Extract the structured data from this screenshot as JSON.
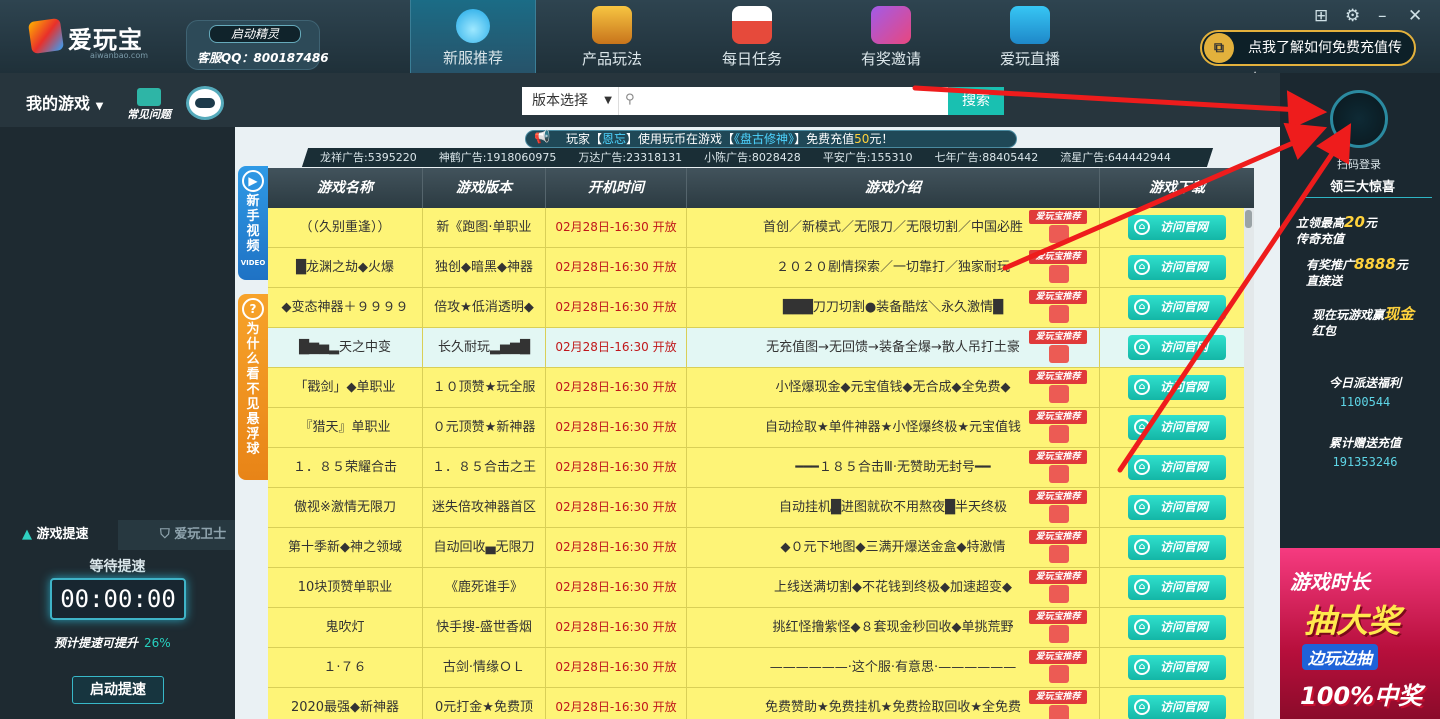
{
  "app": {
    "name": "爱玩宝",
    "domain": "aiwanbao.com"
  },
  "helper": {
    "button": "启动精灵",
    "qq": "客服QQ：800187486"
  },
  "nav": [
    {
      "label": "新服推荐",
      "icon": "drop-icon",
      "active": true
    },
    {
      "label": "产品玩法",
      "icon": "treasure-chest-icon",
      "active": false
    },
    {
      "label": "每日任务",
      "icon": "calendar-icon",
      "active": false
    },
    {
      "label": "有奖邀请",
      "icon": "invite-card-icon",
      "active": false
    },
    {
      "label": "爱玩直播",
      "icon": "tv-icon",
      "active": false
    }
  ],
  "recharge": {
    "label": "点我了解如何免费充值传奇"
  },
  "subbar": {
    "mygames": "我的游戏",
    "faq": "常见问题"
  },
  "search": {
    "version_label": "版本选择",
    "placeholder": "",
    "button": "搜索"
  },
  "ticker": {
    "p1": "玩家【",
    "player": "恩忘",
    "p2": "】使用玩币在游戏【",
    "game": "《盘古修神》",
    "p3": "】免费充值",
    "amount": "50",
    "p4": "元！"
  },
  "ads": [
    "龙祥广告:5395220",
    "神鹤广告:1918060975",
    "万达广告:23318131",
    "小陈广告:8028428",
    "平安广告:155310",
    "七年广告:88405442",
    "流星广告:644442944"
  ],
  "sidetabs": {
    "video": {
      "text": "新手视频",
      "sub": "VIDEO"
    },
    "question": {
      "text": "为什么看不见悬浮球"
    }
  },
  "table": {
    "headers": [
      "游戏名称",
      "游戏版本",
      "开机时间",
      "游戏介绍",
      "游戏下载"
    ],
    "badge": "爱玩宝推荐",
    "visit": "访问官网",
    "rows": [
      {
        "name": "（（久别重逢））",
        "version": "新《跑图·单职业",
        "time": "02月28日-16:30 开放",
        "intro": "首创／新模式／无限刀／无限切割／中国必胜"
      },
      {
        "name": "█龙渊之劫◆火爆",
        "version": "独创◆暗黑◆神器",
        "time": "02月28日-16:30 开放",
        "intro": "２０２０剧情探索／一切靠打／独家耐玩"
      },
      {
        "name": "◆变态神器＋９９９９",
        "version": "倍攻★低消透明◆",
        "time": "02月28日-16:30 开放",
        "intro": "███刀刀切割●装备酷炫＼永久激情█"
      },
      {
        "name": "█▆▅▂天之中变",
        "version": "长久耐玩▂▅▆█",
        "time": "02月28日-16:30 开放",
        "intro": "无充值图→无回馈→装备全爆→散人吊打土豪"
      },
      {
        "name": "「戳剑」◆单职业",
        "version": "１０顶赞★玩全服",
        "time": "02月28日-16:30 开放",
        "intro": "小怪爆现金◆元宝值钱◆无合成◆全免费◆"
      },
      {
        "name": "『猎天』单职业",
        "version": "０元顶赞★新神器",
        "time": "02月28日-16:30 开放",
        "intro": "自动捡取★单件神器★小怪爆终极★元宝值钱"
      },
      {
        "name": "１．８５荣耀合击",
        "version": "１．８５合击之王",
        "time": "02月28日-16:30 开放",
        "intro": "━━━１８５合击Ⅲ·无赞助无封号━━"
      },
      {
        "name": "傲视※激情无限刀",
        "version": "迷失倍攻神器首区",
        "time": "02月28日-16:30 开放",
        "intro": "自动挂机█进图就砍不用熬夜█半天终极"
      },
      {
        "name": "第十季新◆神之领域",
        "version": "自动回收▄无限刀",
        "time": "02月28日-16:30 开放",
        "intro": "◆０元下地图◆三满开爆送金盒◆特激情"
      },
      {
        "name": "10块顶赞单职业",
        "version": "《鹿死谁手》",
        "time": "02月28日-16:30 开放",
        "intro": "上线送满切割◆不花钱到终极◆加速超变◆"
      },
      {
        "name": "鬼吹灯",
        "version": "快手搜-盛世香烟",
        "time": "02月28日-16:30 开放",
        "intro": "挑红怪撸紫怪◆８套现金秒回收◆单挑荒野"
      },
      {
        "name": "１·７６",
        "version": "古剑·情缘ＯＬ",
        "time": "02月28日-16:30 开放",
        "intro": "——————·这个服·有意思·——————"
      },
      {
        "name": "2020最强◆新神器",
        "version": "0元打金★免费顶",
        "time": "02月28日-16:30 开放",
        "intro": "免费赞助★免费挂机★免费捡取回收★全免费"
      }
    ]
  },
  "boost": {
    "tab_active": "游戏提速",
    "tab_other": "爱玩卫士",
    "waiting": "等待提速",
    "timer": "00:00:00",
    "predict_label": "预计提速可提升",
    "predict_value": "26%",
    "start": "启动提速"
  },
  "right": {
    "scan": "扫码登录",
    "gift": "领三大惊喜",
    "promo1": {
      "a": "立领最高",
      "num": "20",
      "b": "元",
      "c": "传奇充值"
    },
    "promo2": {
      "a": "有奖推广",
      "num": "8888",
      "b": "元",
      "c": "直接送"
    },
    "promo3": {
      "a": "现在玩游戏赢",
      "num": "现金",
      "c": "红包"
    },
    "stat1": {
      "label": "今日派送福利",
      "value": "1100544"
    },
    "stat2": {
      "label": "累计赠送充值",
      "value": "191353246"
    }
  },
  "lottery": {
    "a": "游戏时长",
    "b": "抽大奖",
    "c": "边玩边抽",
    "d": "100%中奖"
  },
  "colors": {
    "accent": "#19c0b1",
    "row": "#fef477",
    "row_selected": "#e3f7f4",
    "time_red": "#c0171b",
    "arrow": "#ee1c1c"
  }
}
